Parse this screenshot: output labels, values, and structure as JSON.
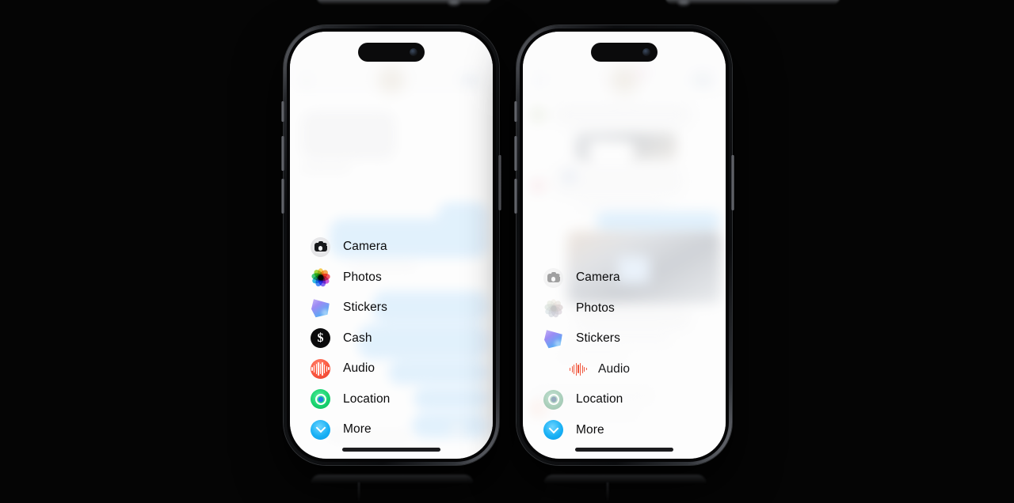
{
  "scene": {
    "background_color": "#050505",
    "device_count": 2,
    "device_model": "iPhone with Dynamic Island"
  },
  "phones": [
    {
      "id": "phone-left",
      "state_label": "iMessage app drawer expanded",
      "menu": {
        "items": [
          {
            "label": "Camera",
            "icon": "camera-icon",
            "inset": false,
            "dim": "none"
          },
          {
            "label": "Photos",
            "icon": "photos-icon",
            "inset": false,
            "dim": "none"
          },
          {
            "label": "Stickers",
            "icon": "stickers-icon",
            "inset": false,
            "dim": "none"
          },
          {
            "label": "Cash",
            "icon": "cash-icon",
            "inset": false,
            "dim": "none"
          },
          {
            "label": "Audio",
            "icon": "audio-icon",
            "inset": false,
            "dim": "none"
          },
          {
            "label": "Location",
            "icon": "location-icon",
            "inset": false,
            "dim": "none"
          },
          {
            "label": "More",
            "icon": "more-icon",
            "inset": false,
            "dim": "none"
          }
        ]
      }
    },
    {
      "id": "phone-right",
      "state_label": "iMessage app drawer mid-transition",
      "menu": {
        "items": [
          {
            "label": "Camera",
            "icon": "camera-icon",
            "inset": false,
            "dim": "medium"
          },
          {
            "label": "Photos",
            "icon": "photos-icon",
            "inset": false,
            "dim": "heavy"
          },
          {
            "label": "Stickers",
            "icon": "stickers-icon",
            "inset": false,
            "dim": "none"
          },
          {
            "label": "Audio",
            "icon": "audio-wave-icon",
            "inset": true,
            "dim": "none"
          },
          {
            "label": "Location",
            "icon": "location-icon",
            "inset": false,
            "dim": "light"
          },
          {
            "label": "More",
            "icon": "more-icon",
            "inset": false,
            "dim": "none"
          }
        ]
      }
    }
  ],
  "colors": {
    "accent_blue": "#19b1f5",
    "bubble_blue": "#b4dcfa",
    "bubble_gray": "#ececee",
    "audio_red": "#fc5c44",
    "location_green": "#19d36e",
    "cash_black": "#0b0b0c",
    "screen_white": "#fdfdfd",
    "label_text": "#0b0b0c"
  }
}
